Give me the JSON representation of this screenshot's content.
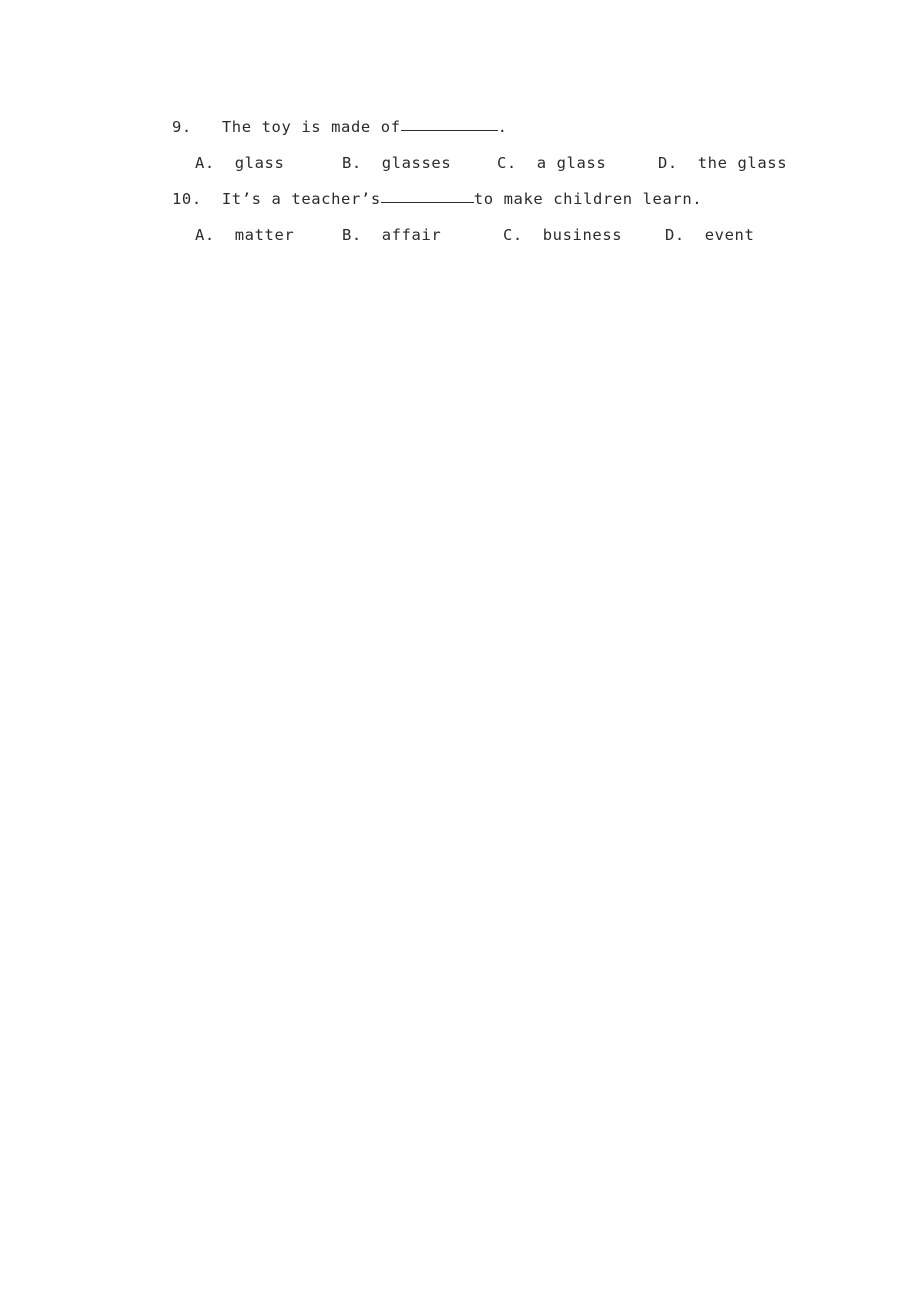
{
  "document": {
    "type": "worksheet-excerpt",
    "background_color": "#ffffff",
    "text_color": "#2b2b2b",
    "questions": [
      {
        "number": "9.",
        "stem_before_blank": "  The toy is made of",
        "stem_after_blank": ".",
        "options": [
          {
            "letter": "A.",
            "text": "  glass"
          },
          {
            "letter": "B.",
            "text": "  glasses"
          },
          {
            "letter": "C.",
            "text": "  a glass"
          },
          {
            "letter": "D.",
            "text": "  the glass"
          }
        ]
      },
      {
        "number": "10.",
        "stem_before_blank": "  It’s a teacher’s",
        "stem_after_blank": "to make children learn.",
        "options": [
          {
            "letter": "A.",
            "text": "  matter"
          },
          {
            "letter": "B.",
            "text": "  affair"
          },
          {
            "letter": "C.",
            "text": "  business"
          },
          {
            "letter": "D.",
            "text": "  event"
          }
        ]
      }
    ]
  }
}
